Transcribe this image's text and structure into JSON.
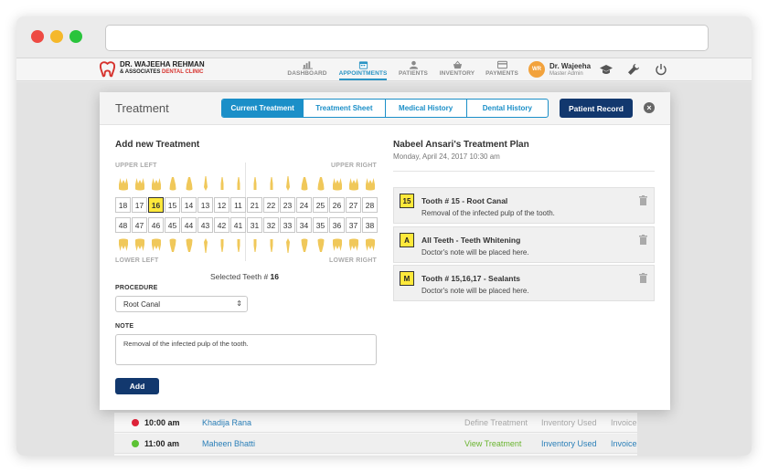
{
  "header": {
    "logo_name": "DR. WAJEEHA REHMAN",
    "logo_sub_a": "& ASSOCIATES ",
    "logo_sub_b": "DENTAL CLINIC",
    "nav": [
      {
        "label": "DASHBOARD",
        "icon": "chart-icon",
        "active": false
      },
      {
        "label": "APPOINTMENTS",
        "icon": "calendar-icon",
        "active": true
      },
      {
        "label": "PATIENTS",
        "icon": "person-icon",
        "active": false
      },
      {
        "label": "INVENTORY",
        "icon": "basket-icon",
        "active": false
      },
      {
        "label": "PAYMENTS",
        "icon": "card-icon",
        "active": false
      }
    ],
    "user": {
      "initials": "WR",
      "name": "Dr. Wajeeha",
      "role": "Master Admin"
    }
  },
  "modal": {
    "title": "Treatment",
    "tabs": [
      "Current Treatment",
      "Treatment Sheet",
      "Medical History",
      "Dental History"
    ],
    "active_tab": 0,
    "patient_record_label": "Patient Record",
    "close_glyph": "×"
  },
  "add_treatment": {
    "title": "Add new Treatment",
    "upper_left": "UPPER LEFT",
    "upper_right": "UPPER RIGHT",
    "lower_left": "LOWER LEFT",
    "lower_right": "LOWER RIGHT",
    "upper_numbers": [
      "18",
      "17",
      "16",
      "15",
      "14",
      "13",
      "12",
      "11",
      "21",
      "22",
      "23",
      "24",
      "25",
      "26",
      "27",
      "28"
    ],
    "lower_numbers": [
      "48",
      "47",
      "46",
      "45",
      "44",
      "43",
      "42",
      "41",
      "31",
      "32",
      "33",
      "34",
      "35",
      "36",
      "37",
      "38"
    ],
    "selected_tooth": "16",
    "selected_label": "Selected Teeth # ",
    "procedure_label": "PROCEDURE",
    "procedure_value": "Root Canal",
    "note_label": "NOTE",
    "note_value": "Removal of the infected pulp of the tooth.",
    "add_label": "Add"
  },
  "plan": {
    "title": "Nabeel Ansari's Treatment Plan",
    "date": "Monday, April 24, 2017 10:30 am",
    "items": [
      {
        "badge": "15",
        "title": "Tooth # 15 - Root Canal",
        "note": "Removal of the infected pulp of the tooth."
      },
      {
        "badge": "A",
        "title": "All Teeth - Teeth Whitening",
        "note": "Doctor's note will be placed here."
      },
      {
        "badge": "M",
        "title": "Tooth # 15,16,17 - Sealants",
        "note": "Doctor's note will be placed here."
      }
    ]
  },
  "appointments": [
    {
      "time": "10:00 am",
      "name": "Khadija Rana",
      "status_color": "#e0243a",
      "action1": "Define Treatment",
      "action2": "Inventory Used",
      "action3": "Invoice"
    },
    {
      "time": "11:00 am",
      "name": "Maheen Bhatti",
      "status_color": "#5cc234",
      "action1": "View Treatment",
      "action2": "Inventory Used",
      "action3": "Invoice"
    }
  ],
  "colors": {
    "accent": "#1b8fc8",
    "navy": "#12386e",
    "tooth": "#f0c85a",
    "highlight": "#ffe93b"
  }
}
